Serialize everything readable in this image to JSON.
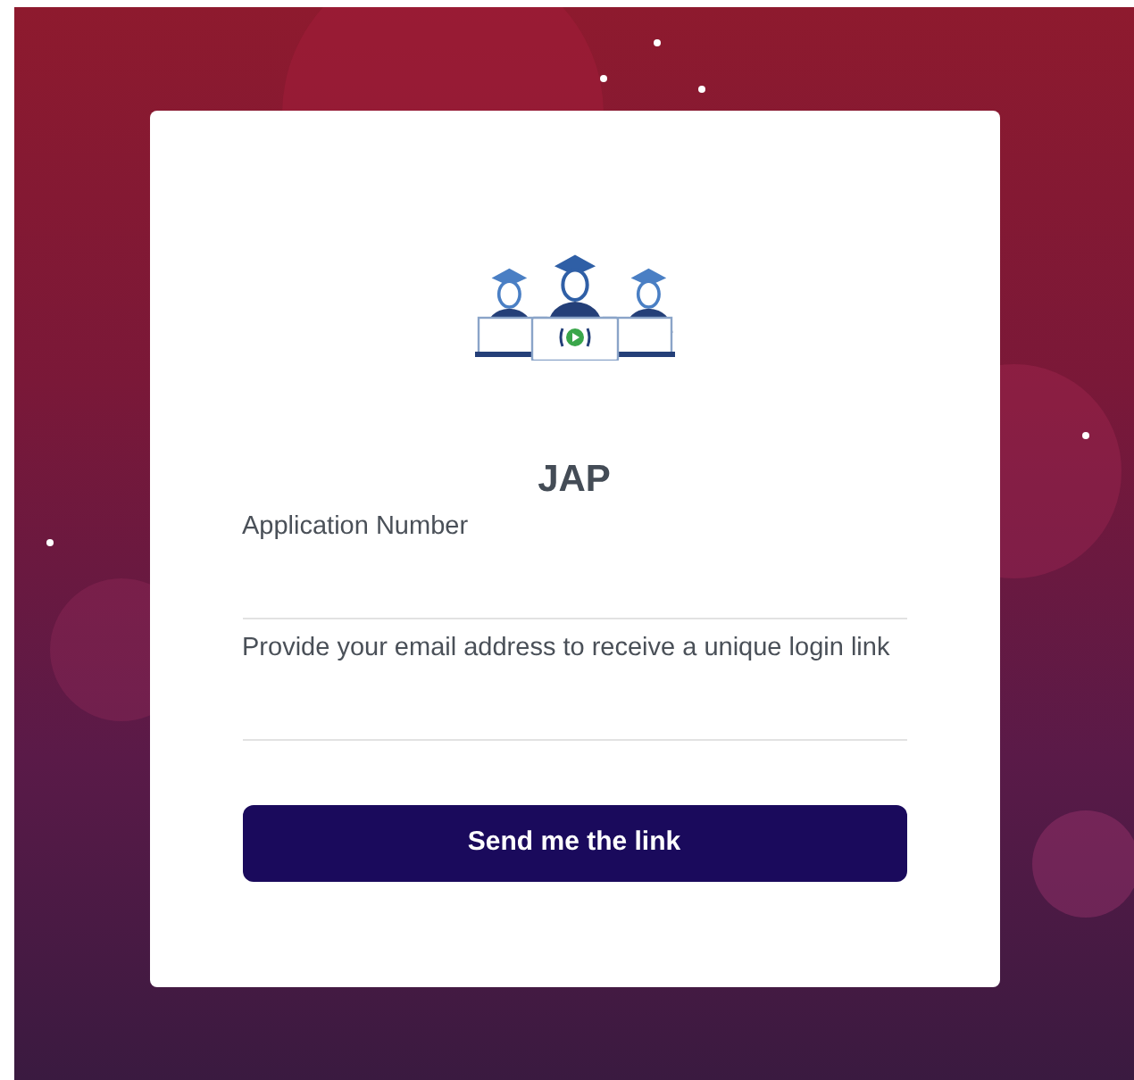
{
  "title": "JAP",
  "fields": [
    {
      "label": "Application Number"
    },
    {
      "label": "Provide your email address to receive a unique login link"
    }
  ],
  "button": "Send me the link"
}
